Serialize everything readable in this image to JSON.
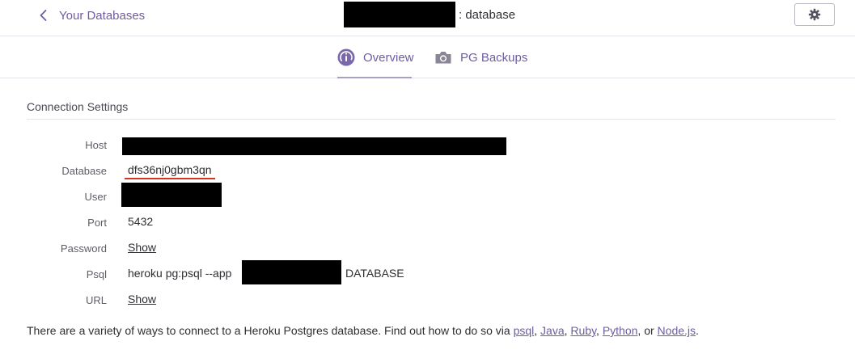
{
  "header": {
    "back_label": "Your Databases",
    "title_suffix": ": database"
  },
  "tabs": [
    {
      "label": "Overview",
      "icon": "overview-gauge-icon",
      "active": true
    },
    {
      "label": "PG Backups",
      "icon": "camera-icon",
      "active": false
    }
  ],
  "section": {
    "title": "Connection Settings"
  },
  "rows": {
    "host_label": "Host",
    "database_label": "Database",
    "database_value": "dfs36nj0gbm3qn",
    "user_label": "User",
    "port_label": "Port",
    "port_value": "5432",
    "password_label": "Password",
    "password_link": "Show",
    "psql_label": "Psql",
    "psql_prefix": "heroku pg:psql --app",
    "psql_suffix": "DATABASE",
    "url_label": "URL",
    "url_link": "Show"
  },
  "footer": {
    "text": "There are a variety of ways to connect to a Heroku Postgres database. Find out how to do so via ",
    "links": [
      "psql",
      "Java",
      "Ruby",
      "Python",
      "Node.js"
    ],
    "sep1": ", ",
    "sep2": ", ",
    "sep3": ", ",
    "sep4": ", or ",
    "end": "."
  },
  "colors": {
    "accent": "#6f5da0",
    "underline_red": "#d6341f"
  }
}
